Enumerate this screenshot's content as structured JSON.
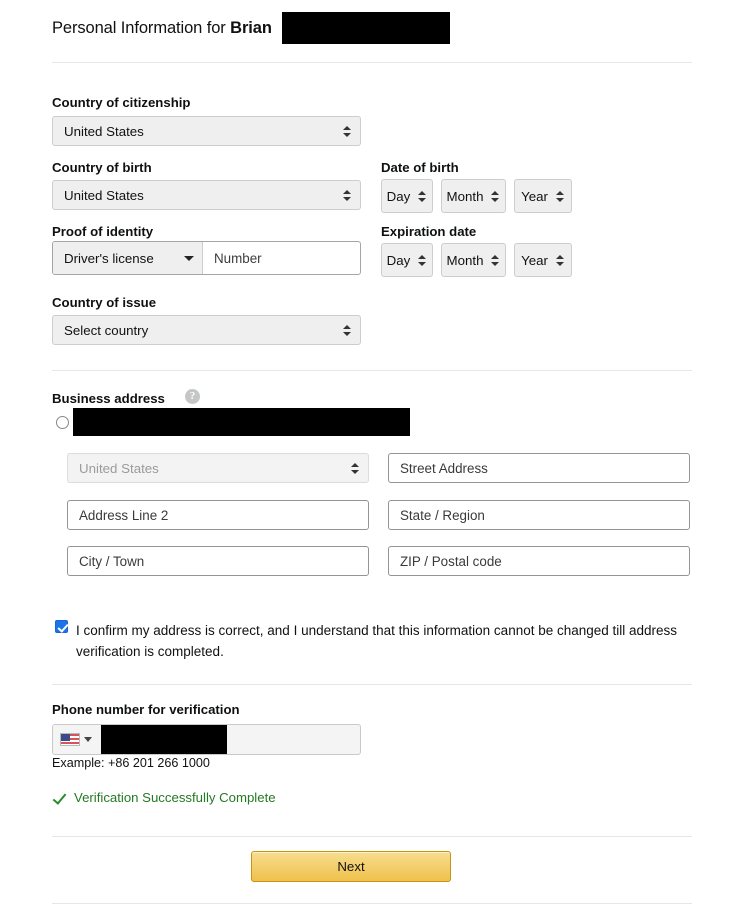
{
  "header": {
    "prefix": "Personal Information for ",
    "name": "Brian",
    "redacted_surname": ""
  },
  "identity": {
    "citizenship_label": "Country of citizenship",
    "citizenship_value": "United States",
    "birth_country_label": "Country of birth",
    "birth_country_value": "United States",
    "proof_label": "Proof of identity",
    "proof_value": "Driver's license",
    "proof_number_placeholder": "Number",
    "issue_country_label": "Country of issue",
    "issue_country_value": "Select country",
    "dob_label": "Date of birth",
    "dob_day": "Day",
    "dob_month": "Month",
    "dob_year": "Year",
    "exp_label": "Expiration date",
    "exp_day": "Day",
    "exp_month": "Month",
    "exp_year": "Year"
  },
  "business_address": {
    "section_label": "Business address",
    "help_glyph": "?",
    "redacted_address_line": "",
    "country_value": "United States",
    "street_placeholder": "Street Address",
    "address2_placeholder": "Address Line 2",
    "state_placeholder": "State / Region",
    "city_placeholder": "City / Town",
    "zip_placeholder": "ZIP / Postal code",
    "confirm_text": "I confirm my address is correct, and I understand that this information cannot be changed till address verification is completed.",
    "confirm_checked": true
  },
  "phone": {
    "label": "Phone number for verification",
    "country_flag": "us-flag-icon",
    "redacted_number": "",
    "example": "Example: +86 201 266 1000",
    "verification_status": "Verification Successfully Complete",
    "verification_color": "#237a23"
  },
  "footer": {
    "next_label": "Next"
  }
}
